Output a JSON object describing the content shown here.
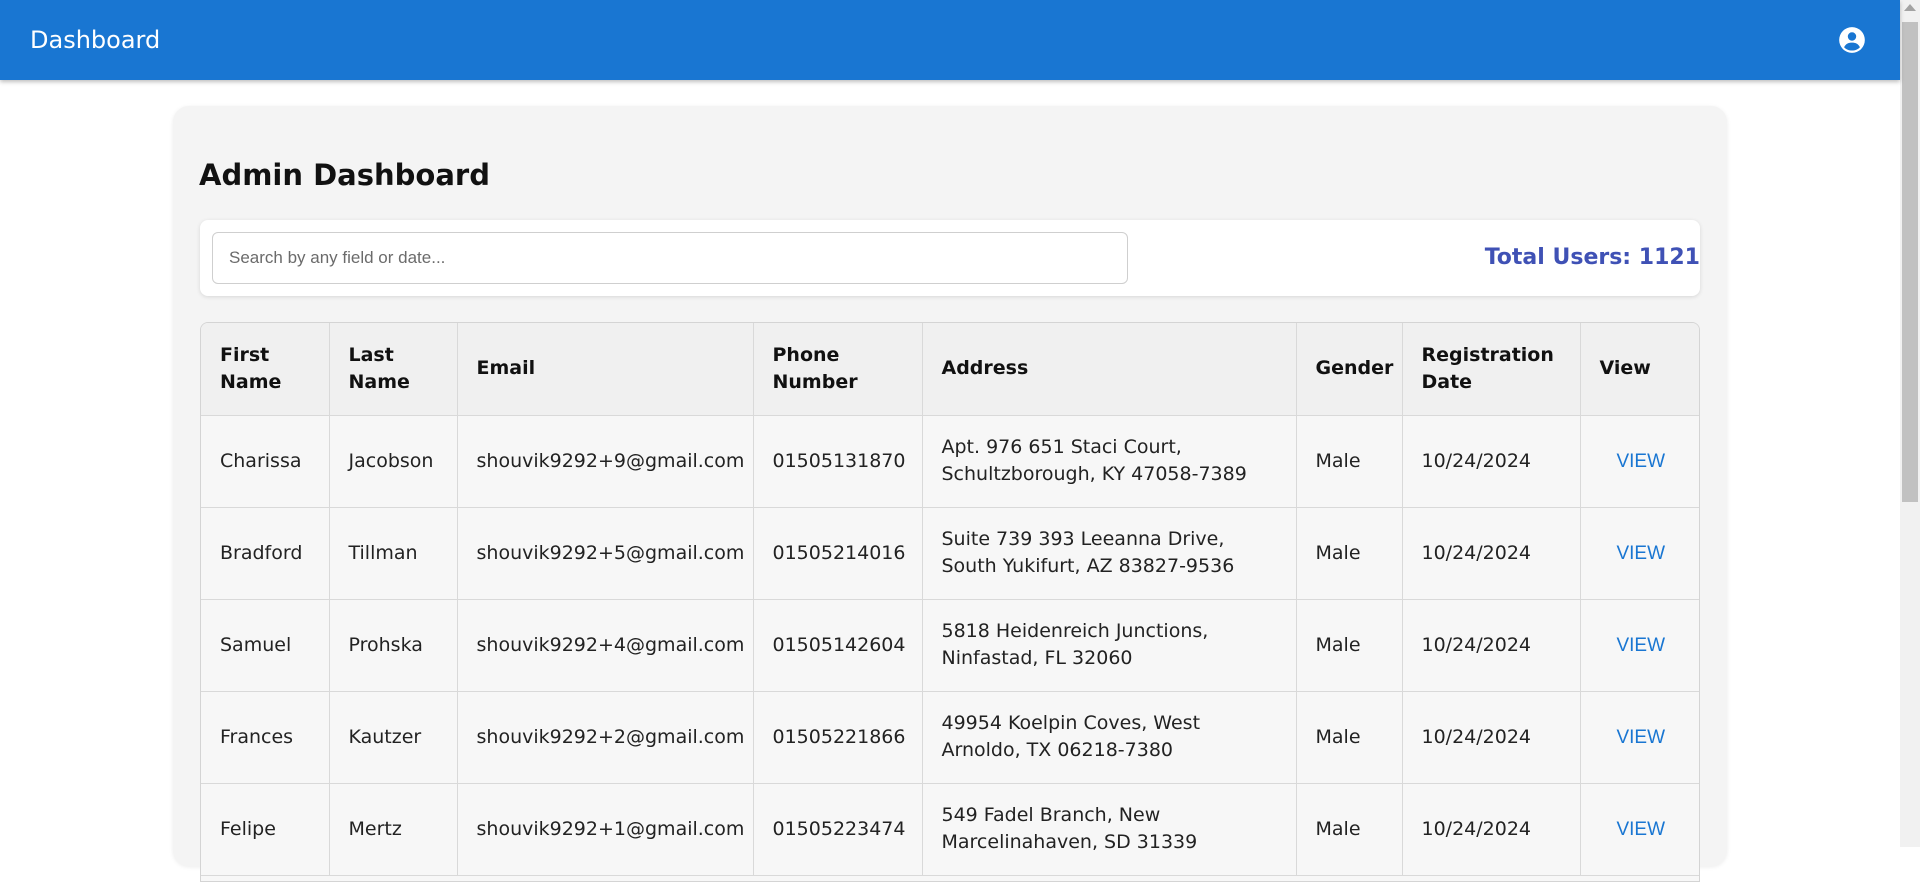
{
  "appbar": {
    "title": "Dashboard",
    "account_icon": "account-circle-icon"
  },
  "main": {
    "title": "Admin Dashboard",
    "search": {
      "placeholder": "Search by any field or date...",
      "value": ""
    },
    "total_users": "Total Users: 1121"
  },
  "table": {
    "columns": [
      "First Name",
      "Last Name",
      "Email",
      "Phone Number",
      "Address",
      "Gender",
      "Registration Date",
      "View"
    ],
    "rows": [
      {
        "first": "Charissa",
        "last": "Jacobson",
        "email": "shouvik9292+9@gmail.com",
        "phone": "01505131870",
        "address": "Apt. 976 651 Staci Court, Schultzborough, KY 47058-7389",
        "gender": "Male",
        "date": "10/24/2024",
        "view": "VIEW"
      },
      {
        "first": "Bradford",
        "last": "Tillman",
        "email": "shouvik9292+5@gmail.com",
        "phone": "01505214016",
        "address": "Suite 739 393 Leeanna Drive, South Yukifurt, AZ 83827-9536",
        "gender": "Male",
        "date": "10/24/2024",
        "view": "VIEW"
      },
      {
        "first": "Samuel",
        "last": "Prohska",
        "email": "shouvik9292+4@gmail.com",
        "phone": "01505142604",
        "address": "5818 Heidenreich Junctions, Ninfastad, FL 32060",
        "gender": "Male",
        "date": "10/24/2024",
        "view": "VIEW"
      },
      {
        "first": "Frances",
        "last": "Kautzer",
        "email": "shouvik9292+2@gmail.com",
        "phone": "01505221866",
        "address": "49954 Koelpin Coves, West Arnoldo, TX 06218-7380",
        "gender": "Male",
        "date": "10/24/2024",
        "view": "VIEW"
      },
      {
        "first": "Felipe",
        "last": "Mertz",
        "email": "shouvik9292+1@gmail.com",
        "phone": "01505223474",
        "address": "549 Fadel Branch, New Marcelinahaven, SD 31339",
        "gender": "Male",
        "date": "10/24/2024",
        "view": "VIEW"
      }
    ]
  },
  "colors": {
    "appbar": "#1976d2",
    "accent": "#3f51b5",
    "link": "#1976d2"
  }
}
